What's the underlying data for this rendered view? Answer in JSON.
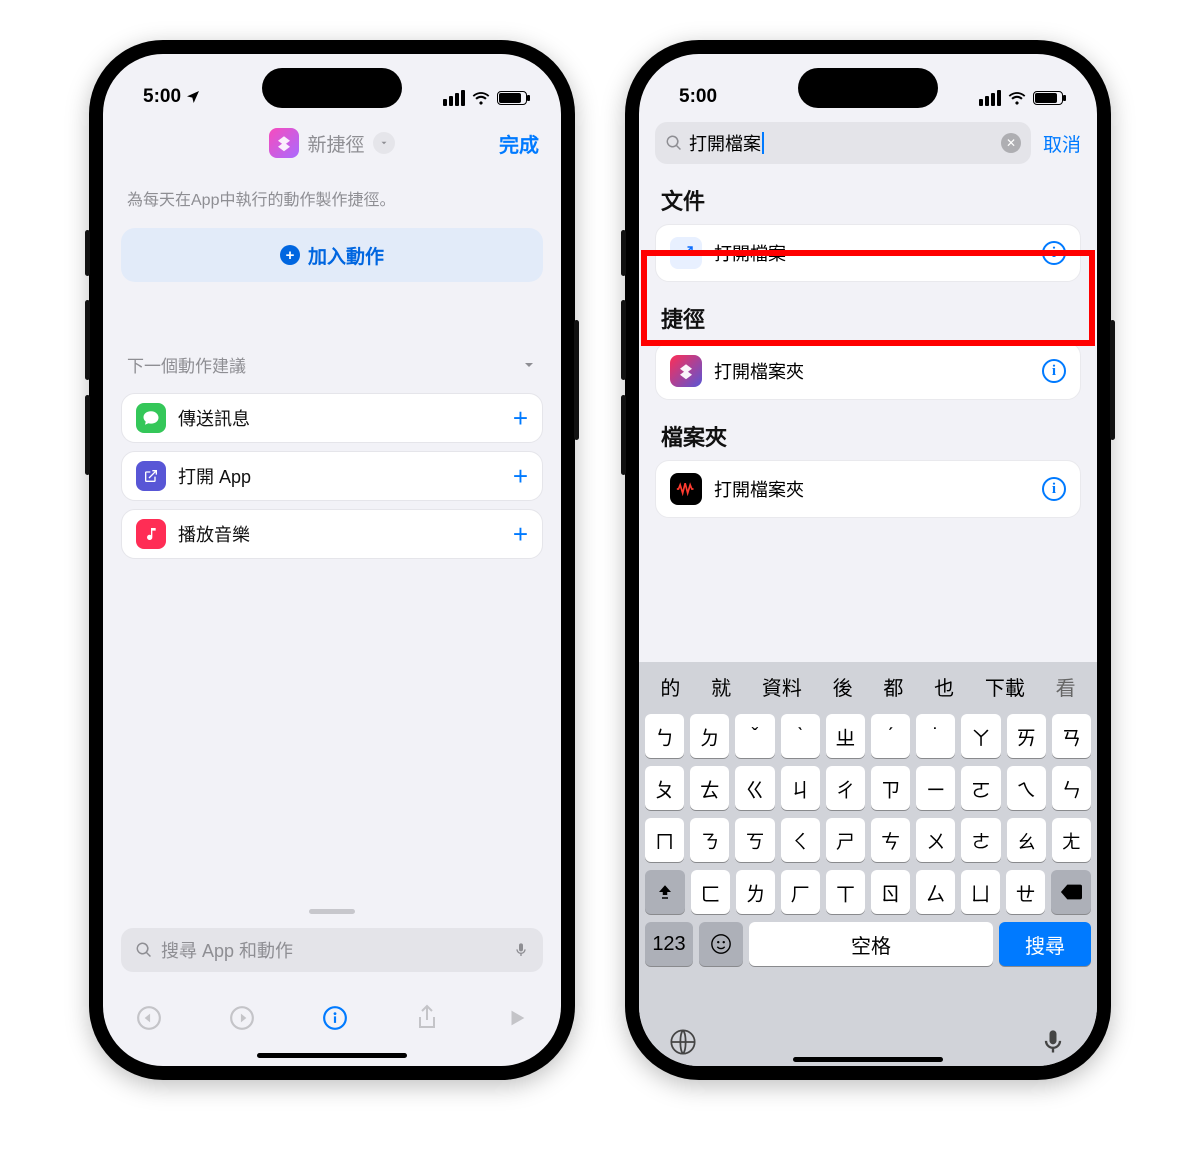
{
  "statusbar": {
    "time": "5:00"
  },
  "left": {
    "title": "新捷徑",
    "done": "完成",
    "caption": "為每天在App中執行的動作製作捷徑。",
    "add_action": "加入動作",
    "suggest_header": "下一個動作建議",
    "suggestions": [
      {
        "label": "傳送訊息"
      },
      {
        "label": "打開 App"
      },
      {
        "label": "播放音樂"
      }
    ],
    "search_placeholder": "搜尋 App 和動作"
  },
  "right": {
    "search_value": "打開檔案",
    "cancel": "取消",
    "section1": "文件",
    "item1": "打開檔案",
    "section2": "捷徑",
    "item2": "打開檔案夾",
    "section3": "檔案夾",
    "item3": "打開檔案夾",
    "candidates": [
      "的",
      "就",
      "資料",
      "後",
      "都",
      "也",
      "下載",
      "看"
    ],
    "kb_rows": [
      [
        "ㄅ",
        "ㄉ",
        "ˇ",
        "ˋ",
        "ㄓ",
        "ˊ",
        "˙",
        "ㄚ",
        "ㄞ",
        "ㄢ"
      ],
      [
        "ㄆ",
        "ㄊ",
        "ㄍ",
        "ㄐ",
        "ㄔ",
        "ㄗ",
        "ㄧ",
        "ㄛ",
        "ㄟ",
        "ㄣ"
      ],
      [
        "ㄇ",
        "ㄋ",
        "ㄎ",
        "ㄑ",
        "ㄕ",
        "ㄘ",
        "ㄨ",
        "ㄜ",
        "ㄠ",
        "ㄤ"
      ],
      [
        "ㄈ",
        "ㄌ",
        "ㄏ",
        "ㄒ",
        "ㄖ",
        "ㄙ",
        "ㄩ",
        "ㄝ",
        "ㄡ",
        "ㄥ"
      ]
    ],
    "kb_row5": [
      "ㄈ",
      "ㄌ",
      "ㄏ",
      "ㄒ",
      "ㄖ",
      "ㄙ",
      "ㄩ",
      "ㄝ",
      "ㄡ",
      "ㄥ"
    ],
    "kb_r5_left": "⇧",
    "kb_r5a": [
      "ㄇ",
      "ㄋ",
      "ㄎ",
      "ㄑ",
      "ㄕ",
      "ㄘ",
      "ㄨ",
      "ㄜ",
      "ㄠ",
      "ㄤ"
    ],
    "spacebar": "空格",
    "returnkey": "搜尋",
    "k123": "123"
  }
}
